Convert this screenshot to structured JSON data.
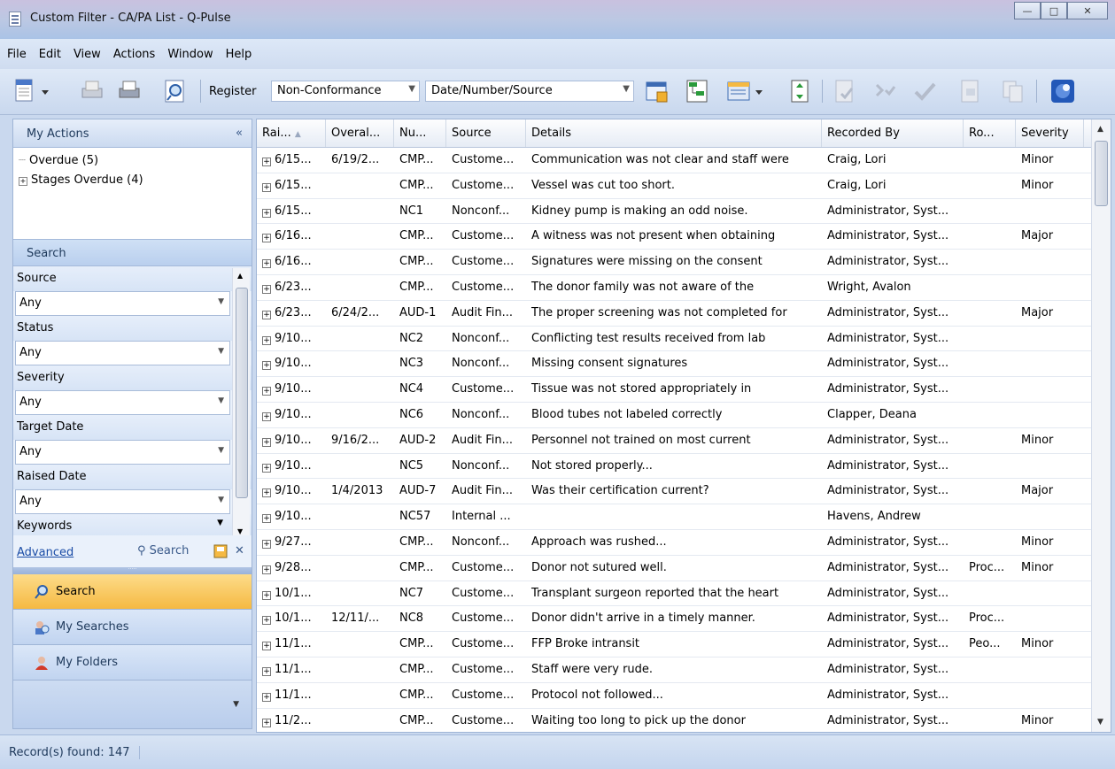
{
  "window": {
    "title": "Custom Filter - CA/PA List - Q-Pulse",
    "minimize": "—",
    "maximize": "□",
    "close": "✕"
  },
  "menu": [
    {
      "label": "File"
    },
    {
      "label": "Edit"
    },
    {
      "label": "View"
    },
    {
      "label": "Actions"
    },
    {
      "label": "Window"
    },
    {
      "label": "Help"
    }
  ],
  "toolbar": {
    "register_label": "Register",
    "register_value": "Non-Conformance",
    "sort_value": "Date/Number/Source"
  },
  "left": {
    "my_actions": "My Actions",
    "collapse": "«",
    "tree": [
      "Overdue (5)",
      "Stages Overdue (4)"
    ],
    "search_head": "Search",
    "fields": [
      {
        "label": "Source",
        "value": "Any"
      },
      {
        "label": "Status",
        "value": "Any"
      },
      {
        "label": "Severity",
        "value": "Any"
      },
      {
        "label": "Target Date",
        "value": "Any"
      },
      {
        "label": "Raised Date",
        "value": "Any"
      },
      {
        "label": "Keywords"
      }
    ],
    "advanced": "Advanced",
    "search_btn": "Search",
    "nav": [
      "Search",
      "My Searches",
      "My Folders"
    ]
  },
  "grid": {
    "columns": [
      "Rai...",
      "Overal...",
      "Nu...",
      "Source",
      "Details",
      "Recorded By",
      "Ro...",
      "Severity"
    ],
    "rows": [
      [
        "6/15...",
        "6/19/2...",
        "CMP...",
        "Custome...",
        "Communication was not clear and staff were",
        "Craig, Lori",
        "",
        "Minor"
      ],
      [
        "6/15...",
        "",
        "CMP...",
        "Custome...",
        "Vessel was cut too short.",
        "Craig, Lori",
        "",
        "Minor"
      ],
      [
        "6/15...",
        "",
        "NC1",
        "Nonconf...",
        "Kidney pump is making an odd noise.",
        "Administrator, Syst...",
        "",
        ""
      ],
      [
        "6/16...",
        "",
        "CMP...",
        "Custome...",
        "A witness was not present when obtaining",
        "Administrator, Syst...",
        "",
        "Major"
      ],
      [
        "6/16...",
        "",
        "CMP...",
        "Custome...",
        "Signatures were missing on the consent",
        "Administrator, Syst...",
        "",
        ""
      ],
      [
        "6/23...",
        "",
        "CMP...",
        "Custome...",
        "The donor family was not aware of the",
        "Wright, Avalon",
        "",
        ""
      ],
      [
        "6/23...",
        "6/24/2...",
        "AUD-1",
        "Audit Fin...",
        "The proper screening was not completed for",
        "Administrator, Syst...",
        "",
        "Major"
      ],
      [
        "9/10...",
        "",
        "NC2",
        "Nonconf...",
        "Conflicting test results received from lab",
        "Administrator, Syst...",
        "",
        ""
      ],
      [
        "9/10...",
        "",
        "NC3",
        "Nonconf...",
        "Missing consent signatures",
        "Administrator, Syst...",
        "",
        ""
      ],
      [
        "9/10...",
        "",
        "NC4",
        "Custome...",
        "Tissue was not stored appropriately in",
        "Administrator, Syst...",
        "",
        ""
      ],
      [
        "9/10...",
        "",
        "NC6",
        "Nonconf...",
        "Blood tubes not labeled correctly",
        "Clapper, Deana",
        "",
        ""
      ],
      [
        "9/10...",
        "9/16/2...",
        "AUD-2",
        "Audit Fin...",
        "Personnel not trained on most current",
        "Administrator, Syst...",
        "",
        "Minor"
      ],
      [
        "9/10...",
        "",
        "NC5",
        "Nonconf...",
        "Not stored properly...",
        "Administrator, Syst...",
        "",
        ""
      ],
      [
        "9/10...",
        "1/4/2013",
        "AUD-7",
        "Audit Fin...",
        "Was their certification current?",
        "Administrator, Syst...",
        "",
        "Major"
      ],
      [
        "9/10...",
        "",
        "NC57",
        "Internal ...",
        "",
        "Havens, Andrew",
        "",
        ""
      ],
      [
        "9/27...",
        "",
        "CMP...",
        "Nonconf...",
        "Approach was rushed...",
        "Administrator, Syst...",
        "",
        "Minor"
      ],
      [
        "9/28...",
        "",
        "CMP...",
        "Custome...",
        "Donor not sutured well.",
        "Administrator, Syst...",
        "Proc...",
        "Minor"
      ],
      [
        "10/1...",
        "",
        "NC7",
        "Custome...",
        "Transplant surgeon reported that the heart",
        "Administrator, Syst...",
        "",
        ""
      ],
      [
        "10/1...",
        "12/11/...",
        "NC8",
        "Custome...",
        "Donor didn't arrive in a timely manner.",
        "Administrator, Syst...",
        "Proc...",
        ""
      ],
      [
        "11/1...",
        "",
        "CMP...",
        "Custome...",
        "FFP Broke intransit",
        "Administrator, Syst...",
        "Peo...",
        "Minor"
      ],
      [
        "11/1...",
        "",
        "CMP...",
        "Custome...",
        "Staff were very rude.",
        "Administrator, Syst...",
        "",
        ""
      ],
      [
        "11/1...",
        "",
        "CMP...",
        "Custome...",
        "Protocol not followed...",
        "Administrator, Syst...",
        "",
        ""
      ],
      [
        "11/2...",
        "",
        "CMP...",
        "Custome...",
        "Waiting too long to pick up the donor",
        "Administrator, Syst...",
        "",
        "Minor"
      ]
    ]
  },
  "status": {
    "text": "Record(s) found: 147"
  }
}
